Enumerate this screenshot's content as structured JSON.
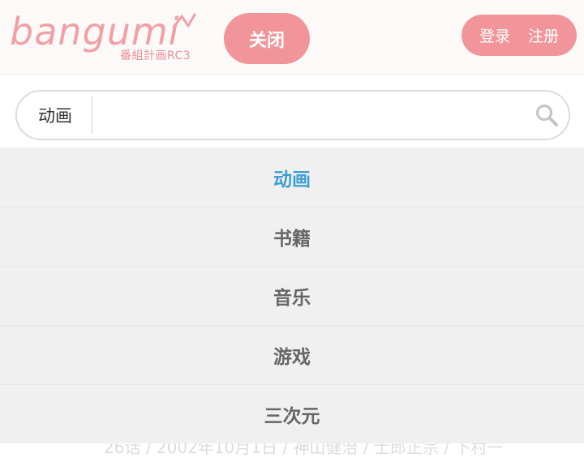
{
  "header": {
    "logo": {
      "wordmark": "bangumi",
      "subtitle": "番組計画RC3",
      "color": "#f2a0a6"
    },
    "close_label": "关闭",
    "auth": {
      "login_label": "登录",
      "register_label": "注册"
    },
    "accent_color": "#f1959a"
  },
  "search": {
    "category": "动画",
    "value": "",
    "placeholder": "",
    "icon": "search-icon"
  },
  "dropdown": {
    "items": [
      {
        "label": "动画",
        "active": true
      },
      {
        "label": "书籍",
        "active": false
      },
      {
        "label": "音乐",
        "active": false
      },
      {
        "label": "游戏",
        "active": false
      },
      {
        "label": "三次元",
        "active": false
      }
    ],
    "active_color": "#3f9fd5"
  },
  "background_content": {
    "partial_text": "26话 / 2002年10月1日 / 神山健治 / 士郎正宗 / 下村一"
  }
}
